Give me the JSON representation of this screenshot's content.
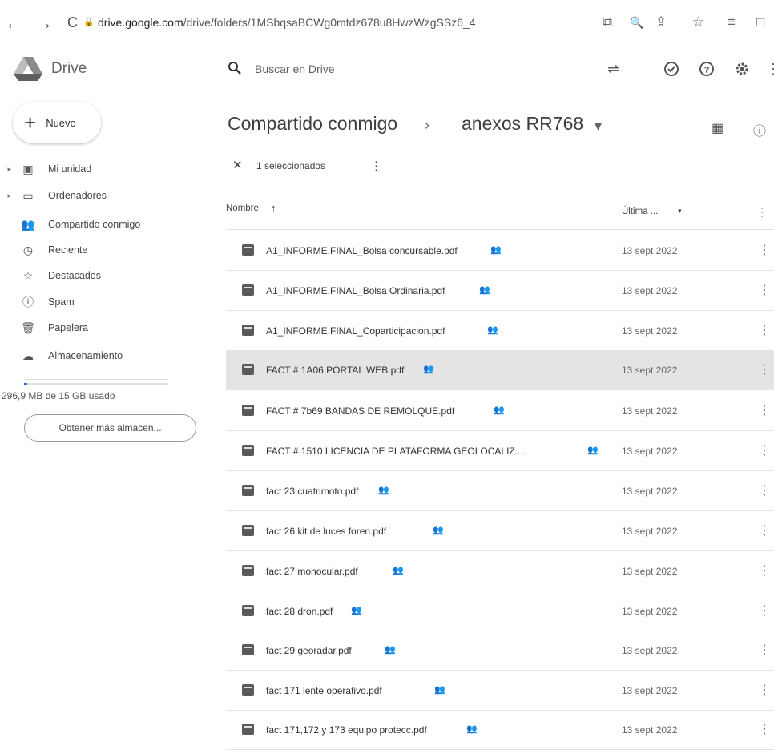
{
  "browser": {
    "url_host": "drive.google.com",
    "url_path": "/drive/folders/1MSbqsaBCWg0mtdz678u8HwzWzgSSz6_4",
    "back": "←",
    "forward": "→",
    "reload": "C",
    "lock": "🔒",
    "right_icons": [
      "⧉",
      "🔍",
      "⇪",
      "☆",
      "≡",
      "□"
    ]
  },
  "header": {
    "logo_text": "Drive",
    "search_placeholder": "Buscar en Drive",
    "icons": {
      "filter": "⇌",
      "status": "⊘",
      "help": "?",
      "settings": "⚙",
      "more": "⋮"
    }
  },
  "sidebar": {
    "new_label": "Nuevo",
    "items": [
      {
        "label": "Mi unidad",
        "icon": "▣",
        "caret": "▸"
      },
      {
        "label": "Ordenadores",
        "icon": "▭",
        "caret": "▸"
      },
      {
        "label": "Compartido conmigo",
        "icon": "👥",
        "caret": ""
      },
      {
        "label": "Reciente",
        "icon": "◷",
        "caret": ""
      },
      {
        "label": "Destacados",
        "icon": "☆",
        "caret": ""
      },
      {
        "label": "Spam",
        "icon": "ⓘ",
        "caret": ""
      },
      {
        "label": "Papelera",
        "icon": "🗑",
        "caret": ""
      },
      {
        "label": "Almacenamiento",
        "icon": "☁",
        "caret": ""
      }
    ],
    "storage_text": "296,9 MB de 15 GB usado",
    "storage_used_fraction": 0.02,
    "storage_button": "Obtener más almacen..."
  },
  "main": {
    "breadcrumb_parent": "Compartido conmigo",
    "breadcrumb_sep": "›",
    "breadcrumb_current": "anexos RR768",
    "breadcrumb_dropdown": "▾",
    "right_icons": {
      "grid": "▦",
      "info": "ⓘ"
    },
    "selection": {
      "close": "✕",
      "text": "1 seleccionados",
      "more": "⋮"
    },
    "columns": {
      "name": "Nombre",
      "sort": "↑",
      "modified": "Última ...",
      "modified_dropdown": "▾",
      "more": "⋮"
    },
    "files": [
      {
        "name": "A1_INFORME.FINAL_Bolsa concursable.pdf",
        "date": "13 sept 2022",
        "selected": false
      },
      {
        "name": "A1_INFORME.FINAL_Bolsa Ordinaria.pdf",
        "date": "13 sept 2022",
        "selected": false
      },
      {
        "name": "A1_INFORME.FINAL_Coparticipacion.pdf",
        "date": "13 sept 2022",
        "selected": false
      },
      {
        "name": "FACT # 1A06 PORTAL WEB.pdf",
        "date": "13 sept 2022",
        "selected": true
      },
      {
        "name": "FACT # 7b69 BANDAS DE REMOLQUE.pdf",
        "date": "13 sept 2022",
        "selected": false
      },
      {
        "name": "FACT # 1510 LICENCIA DE PLATAFORMA GEOLOCALIZ....",
        "date": "13 sept 2022",
        "selected": false
      },
      {
        "name": "fact 23 cuatrimoto.pdf",
        "date": "13 sept 2022",
        "selected": false
      },
      {
        "name": "fact 26 kit de luces foren.pdf",
        "date": "13 sept 2022",
        "selected": false
      },
      {
        "name": "fact 27 monocular.pdf",
        "date": "13 sept 2022",
        "selected": false
      },
      {
        "name": "fact 28 dron.pdf",
        "date": "13 sept 2022",
        "selected": false
      },
      {
        "name": "fact 29 georadar.pdf",
        "date": "13 sept 2022",
        "selected": false
      },
      {
        "name": "fact 171 lente operativo.pdf",
        "date": "13 sept 2022",
        "selected": false
      },
      {
        "name": "fact 171,172 y 173 equipo protecc.pdf",
        "date": "13 sept 2022",
        "selected": false
      }
    ],
    "shared_icon": "👥",
    "row_more": "⋮"
  }
}
